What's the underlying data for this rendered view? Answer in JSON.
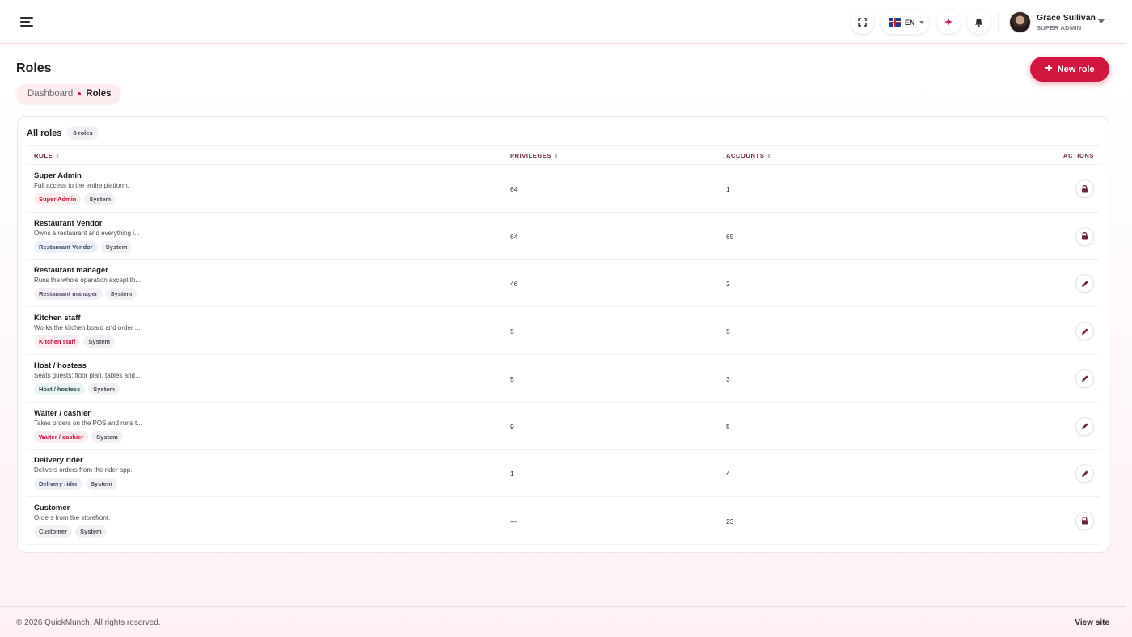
{
  "header": {
    "language": "EN",
    "user": {
      "name": "Grace Sullivan",
      "role": "SUPER ADMIN"
    }
  },
  "page": {
    "title": "Roles",
    "breadcrumb": [
      "Dashboard",
      "Roles"
    ],
    "new_role_label": "New role"
  },
  "card": {
    "title": "All roles",
    "count": "8 roles",
    "columns": {
      "role": "ROLE",
      "privileges": "PRIVILEGES",
      "accounts": "ACCOUNTS",
      "actions": "ACTIONS"
    }
  },
  "roles": [
    {
      "name": "Super Admin",
      "desc": "Full access to the entire platform.",
      "chip": "Super Admin",
      "chip_style": "red",
      "tag": "System",
      "privileges": "64",
      "accounts": "1",
      "action": "lock"
    },
    {
      "name": "Restaurant Vendor",
      "desc": "Owns a restaurant and everything i...",
      "chip": "Restaurant Vendor",
      "chip_style": "blue",
      "tag": "System",
      "privileges": "64",
      "accounts": "65",
      "action": "lock"
    },
    {
      "name": "Restaurant manager",
      "desc": "Runs the whole operation except th...",
      "chip": "Restaurant manager",
      "chip_style": "purple",
      "tag": "System",
      "privileges": "46",
      "accounts": "2",
      "action": "edit"
    },
    {
      "name": "Kitchen staff",
      "desc": "Works the kitchen board and order ...",
      "chip": "Kitchen staff",
      "chip_style": "red",
      "tag": "System",
      "privileges": "5",
      "accounts": "5",
      "action": "edit"
    },
    {
      "name": "Host / hostess",
      "desc": "Seats guests: floor plan, tables and...",
      "chip": "Host / hostess",
      "chip_style": "teal",
      "tag": "System",
      "privileges": "5",
      "accounts": "3",
      "action": "edit"
    },
    {
      "name": "Waiter / cashier",
      "desc": "Takes orders on the POS and runs t...",
      "chip": "Waiter / cashier",
      "chip_style": "red",
      "tag": "System",
      "privileges": "9",
      "accounts": "5",
      "action": "edit"
    },
    {
      "name": "Delivery rider",
      "desc": "Delivers orders from the rider app.",
      "chip": "Delivery rider",
      "chip_style": "lav",
      "tag": "System",
      "privileges": "1",
      "accounts": "4",
      "action": "edit"
    },
    {
      "name": "Customer",
      "desc": "Orders from the storefront.",
      "chip": "Customer",
      "chip_style": "grey",
      "tag": "System",
      "privileges": "—",
      "accounts": "23",
      "action": "lock"
    }
  ],
  "footer": {
    "copyright": "© 2026 QuickMunch. All rights reserved.",
    "view_site": "View site"
  },
  "colors": {
    "accent": "#d3163f",
    "action_icon": "#6b2735"
  }
}
